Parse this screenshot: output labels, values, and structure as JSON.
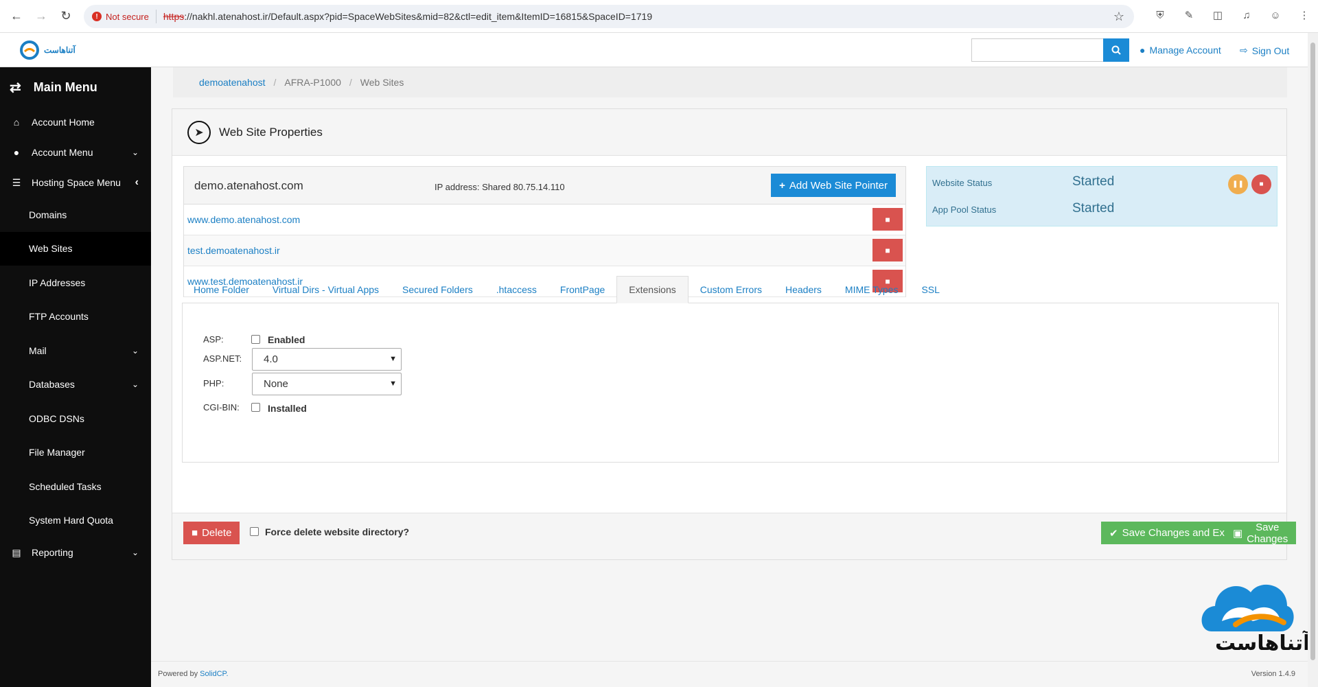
{
  "browser": {
    "security_label": "Not secure",
    "url_protocol": "https",
    "url_rest": "://nakhl.atenahost.ir/Default.aspx?pid=SpaceWebSites&mid=82&ctl=edit_item&ItemID=16815&SpaceID=1719"
  },
  "header": {
    "logo_text": "آتناهاست",
    "search_placeholder": "",
    "manage_account": "Manage Account",
    "sign_out": "Sign Out"
  },
  "sidebar": {
    "title": "Main Menu",
    "items": [
      {
        "label": "Account Home"
      },
      {
        "label": "Account Menu"
      },
      {
        "label": "Hosting Space Menu"
      },
      {
        "label": "Domains"
      },
      {
        "label": "Web Sites"
      },
      {
        "label": "IP Addresses"
      },
      {
        "label": "FTP Accounts"
      },
      {
        "label": "Mail"
      },
      {
        "label": "Databases"
      },
      {
        "label": "ODBC DSNs"
      },
      {
        "label": "File Manager"
      },
      {
        "label": "Scheduled Tasks"
      },
      {
        "label": "System Hard Quota"
      },
      {
        "label": "Reporting"
      }
    ]
  },
  "breadcrumb": [
    "demoatenahost",
    "AFRA-P1000",
    "Web Sites"
  ],
  "panel": {
    "title": "Web Site Properties",
    "site_name": "demo.atenahost.com",
    "ip_address": "IP address: Shared 80.75.14.110",
    "add_pointer": "Add Web Site Pointer",
    "pointers": [
      "www.demo.atenahost.com",
      "test.demoatenahost.ir",
      "www.test.demoatenahost.ir"
    ],
    "status": {
      "website_label": "Website Status",
      "website_value": "Started",
      "pool_label": "App Pool Status",
      "pool_value": "Started"
    },
    "tabs": [
      "Home Folder",
      "Virtual Dirs - Virtual Apps",
      "Secured Folders",
      ".htaccess",
      "FrontPage",
      "Extensions",
      "Custom Errors",
      "Headers",
      "MIME Types",
      "SSL"
    ],
    "active_tab": "Extensions",
    "extensions": {
      "asp_label": "ASP:",
      "asp_check": "Enabled",
      "aspnet_label": "ASP.NET:",
      "aspnet_value": "4.0",
      "php_label": "PHP:",
      "php_value": "None",
      "cgi_label": "CGI-BIN:",
      "cgi_check": "Installed"
    },
    "delete_btn": "Delete",
    "force_delete": "Force delete website directory?",
    "save_exit": "Save Changes and Exit",
    "save": "Save Changes"
  },
  "footer": {
    "powered_prefix": "Powered by ",
    "powered_link": "SolidCP.",
    "version": "Version 1.4.9"
  },
  "brand_text": "آتناهاست",
  "colors": {
    "primary": "#1b8bd6",
    "danger": "#d9534f",
    "success": "#5cb85c",
    "warning": "#f0ad4e",
    "sidebar": "#0e0e0e"
  }
}
